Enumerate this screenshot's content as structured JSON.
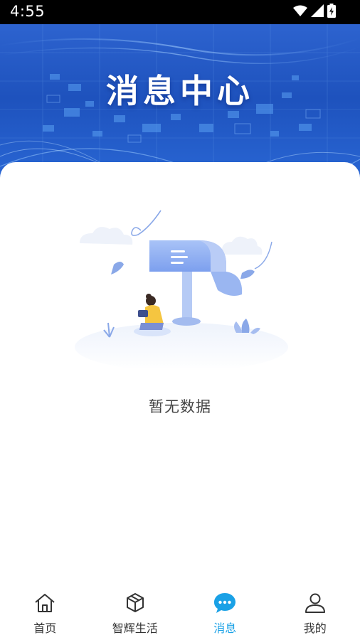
{
  "status_bar": {
    "time": "4:55",
    "icons": [
      "wifi-icon",
      "cellular-signal-icon",
      "battery-charging-icon"
    ]
  },
  "header": {
    "title": "消息中心"
  },
  "empty_state": {
    "message": "暂无数据",
    "illustration": "mailbox-empty-illustration"
  },
  "tab_bar": {
    "active_color": "#1aa1e6",
    "items": [
      {
        "label": "首页",
        "icon": "home-icon",
        "active": false
      },
      {
        "label": "智辉生活",
        "icon": "cube-icon",
        "active": false
      },
      {
        "label": "消息",
        "icon": "chat-bubble-icon",
        "active": true
      },
      {
        "label": "我的",
        "icon": "user-icon",
        "active": false
      }
    ]
  }
}
